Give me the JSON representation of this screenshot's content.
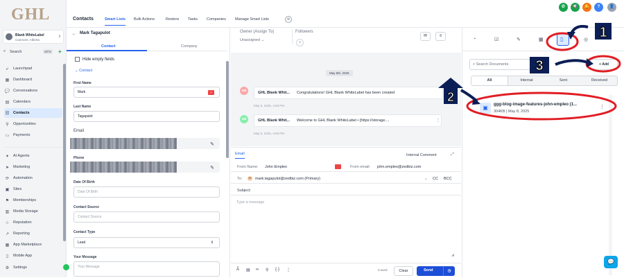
{
  "brand": {
    "logo_text": "GHL"
  },
  "account": {
    "name": "Blank WhiteLabel",
    "location": "Canmore, Alberta"
  },
  "search": {
    "label": "Search",
    "shortcut": "ctrl K"
  },
  "sidebar": {
    "items": [
      {
        "label": "Launchpad",
        "icon": "rocket-icon"
      },
      {
        "label": "Dashboard",
        "icon": "dashboard-icon"
      },
      {
        "label": "Conversations",
        "icon": "chat-icon"
      },
      {
        "label": "Calendars",
        "icon": "calendar-icon"
      },
      {
        "label": "Contacts",
        "icon": "contacts-icon",
        "active": true
      },
      {
        "label": "Opportunities",
        "icon": "funnel-icon"
      },
      {
        "label": "Payments",
        "icon": "payments-icon"
      },
      {
        "label": "AI Agents",
        "icon": "sparkle-icon"
      },
      {
        "label": "Marketing",
        "icon": "send-icon"
      },
      {
        "label": "Automation",
        "icon": "automation-icon"
      },
      {
        "label": "Sites",
        "icon": "sites-icon"
      },
      {
        "label": "Memberships",
        "icon": "memberships-icon"
      },
      {
        "label": "Media Storage",
        "icon": "media-icon"
      },
      {
        "label": "Reputation",
        "icon": "star-icon"
      },
      {
        "label": "Reporting",
        "icon": "chart-icon"
      },
      {
        "label": "App Marketplace",
        "icon": "grid-icon"
      },
      {
        "label": "Mobile App",
        "icon": "phone-icon"
      },
      {
        "label": "Settings",
        "icon": "gear-icon"
      }
    ]
  },
  "topnav": {
    "title": "Contacts",
    "tabs": [
      "Smart Lists",
      "Bulk Actions",
      "Restore",
      "Tasks",
      "Companies",
      "Manage Smart Lists"
    ],
    "header_badges": [
      {
        "icon": "phone-icon",
        "color": "#16a34a"
      },
      {
        "icon": "megaphone-icon",
        "color": "#16a34a"
      },
      {
        "icon": "bell-icon",
        "color": "#f97316"
      },
      {
        "icon": "help-icon",
        "color": "#3b82f6"
      }
    ]
  },
  "contact": {
    "name": "Mark Tagapulot",
    "tabs": [
      "Contact",
      "Company"
    ],
    "hide_empty": "Hide empty fields",
    "section": "Contact",
    "fields": {
      "first_name_label": "First Name",
      "first_name": "Mark",
      "last_name_label": "Last Name",
      "last_name": "Tagapulot",
      "email_label": "Email",
      "phone_label": "Phone",
      "dob_label": "Date Of Birth",
      "dob_placeholder": "Date Of Birth",
      "source_label": "Contact Source",
      "source_placeholder": "Contact Source",
      "type_label": "Contact Type",
      "type_value": "Lead",
      "message_label": "Your Message",
      "message_placeholder": "Your Message"
    }
  },
  "conversation": {
    "owner_label": "Owner (Assign To)",
    "owner_value": "Unassigned",
    "followers_label": "Followers",
    "date_chip": "May 5th, 2025",
    "messages": [
      {
        "avatar": "GB",
        "sender": "GHL Blank Whit...",
        "text": "Congratulations! GHL Blank WhiteLabel has been created",
        "time": "May 5, 2025, 4:58 PM",
        "color": "#f9a8a8"
      },
      {
        "avatar": "GB",
        "sender": "GHL Blank Whit...",
        "text": "Welcome to GHL Blank WhiteLabel  •  [https://storage....",
        "time": "May 5, 2025, 4:58 PM",
        "color": "#86efac"
      }
    ]
  },
  "composer": {
    "tab_email": "Email",
    "tab_internal": "Internal Comment",
    "from_name_label": "From Name:",
    "from_name": "John Empleo",
    "from_email_label": "From email:",
    "from_email": "john.empleo@zedbiz.com",
    "to_label": "To:",
    "to_avatar": "Mt",
    "to_value": "mark.tagapulot@zedbiz.com (Primary)",
    "cc": "CC",
    "bcc": "BCC",
    "subject_label": "Subject:",
    "message_placeholder": "Type a message",
    "word_count": "0 word",
    "clear": "Clear",
    "send": "Send"
  },
  "documents": {
    "search_placeholder": "Search Documents",
    "add": "+ Add",
    "tabs": [
      "All",
      "Internal",
      "Sent",
      "Received"
    ],
    "item": {
      "name": "ggg-blog-image-features-john-empleo (1...",
      "meta": "304KB | May 8, 2025"
    }
  },
  "annotations": [
    "1",
    "2",
    "3"
  ]
}
